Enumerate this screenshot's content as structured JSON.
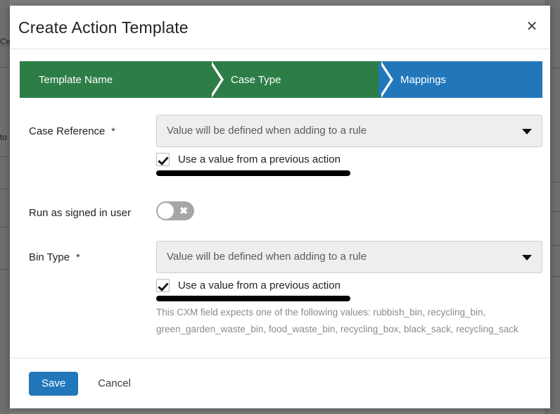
{
  "colors": {
    "step_complete": "#2d7d46",
    "step_active": "#2277bb",
    "primary_button": "#2277bb",
    "backdrop": "#7c7c7c",
    "redaction": "#000000"
  },
  "background_page": {
    "fragment_top": "Ce",
    "fragment_mid": "to"
  },
  "modal": {
    "title": "Create Action Template",
    "close_icon": "close-icon",
    "close_glyph": "✕"
  },
  "stepper": {
    "steps": [
      {
        "label": "Template Name",
        "state": "complete"
      },
      {
        "label": "Case Type",
        "state": "complete"
      },
      {
        "label": "Mappings",
        "state": "active"
      }
    ]
  },
  "form": {
    "case_reference": {
      "label": "Case Reference",
      "required_marker": "*",
      "select_value": "Value will be defined when adding to a rule",
      "dropdown_icon": "chevron-down-icon",
      "checkbox_label": "Use a value from a previous action",
      "checkbox_checked": true,
      "redacted_value": ""
    },
    "run_as_signed_in_user": {
      "label": "Run as signed in user",
      "toggle_state": "off",
      "toggle_glyph": "✖"
    },
    "bin_type": {
      "label": "Bin Type",
      "required_marker": "*",
      "select_value": "Value will be defined when adding to a rule",
      "dropdown_icon": "chevron-down-icon",
      "checkbox_label": "Use a value from a previous action",
      "checkbox_checked": true,
      "redacted_value": "",
      "helper_text": "This CXM field expects one of the following values: rubbish_bin, recycling_bin, green_garden_waste_bin, food_waste_bin, recycling_box, black_sack, recycling_sack"
    }
  },
  "footer": {
    "save_label": "Save",
    "cancel_label": "Cancel"
  }
}
